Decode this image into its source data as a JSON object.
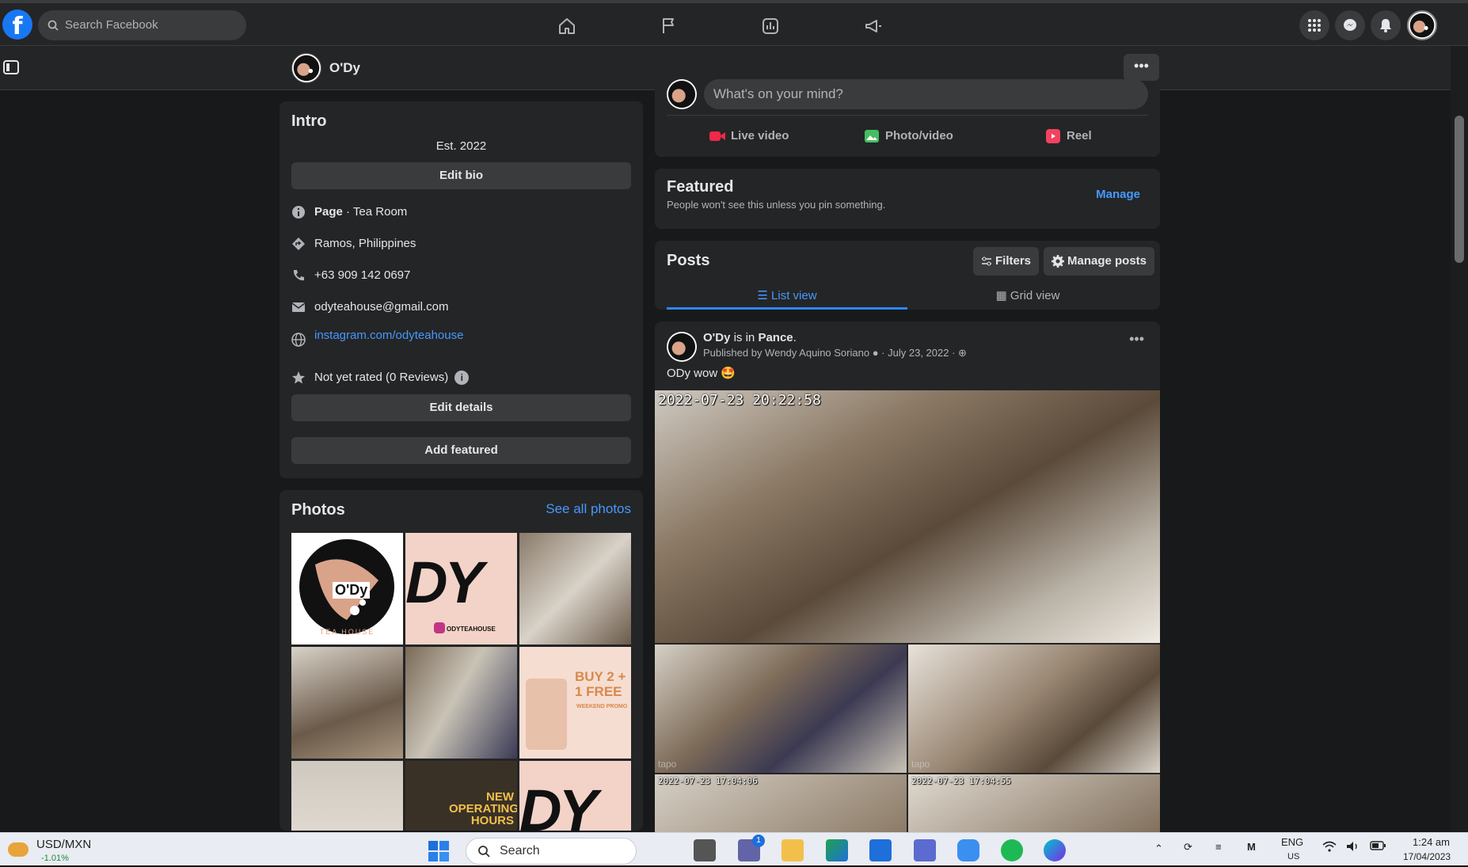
{
  "topbar": {
    "logo": "f",
    "search_placeholder": "Search Facebook"
  },
  "pagebar": {
    "page_name": "O'Dy",
    "more": "•••"
  },
  "intro": {
    "title": "Intro",
    "est": "Est. 2022",
    "edit_bio": "Edit bio",
    "page_label_bold": "Page",
    "page_label_rest": " · Tea Room",
    "location": "Ramos, Philippines",
    "phone": "+63 909 142 0697",
    "email": "odyteahouse@gmail.com",
    "website": "instagram.com/odyteahouse",
    "rating": "Not yet rated (0 Reviews)",
    "edit_details": "Edit details",
    "add_featured": "Add featured"
  },
  "photos": {
    "title": "Photos",
    "see_all": "See all photos",
    "tiles": [
      {
        "label": "O'Dy",
        "sub": "TEA HOUSE"
      },
      {
        "label": "DY",
        "sub": "ODYTEAHOUSE"
      },
      {
        "label": "",
        "sub": ""
      },
      {
        "label": "",
        "sub": ""
      },
      {
        "label": "",
        "sub": ""
      },
      {
        "label": "BUY 2 + 1 FREE",
        "sub": "WEEKEND PROMO"
      },
      {
        "label": "",
        "sub": ""
      },
      {
        "label": "NEW OPERATING HOURS",
        "sub": ""
      },
      {
        "label": "DY",
        "sub": ""
      }
    ]
  },
  "composer": {
    "placeholder": "What's on your mind?",
    "live": "Live video",
    "photo": "Photo/video",
    "reel": "Reel"
  },
  "featured": {
    "title": "Featured",
    "subtitle": "People won't see this unless you pin something.",
    "manage": "Manage"
  },
  "posts": {
    "title": "Posts",
    "filters": "Filters",
    "manage_posts": "Manage posts",
    "list_view": "List view",
    "grid_view": "Grid view"
  },
  "post": {
    "author": "O'Dy",
    "is_in": " is in ",
    "place": "Pance",
    "published_by": "Published by Wendy Aquino Soriano",
    "date": "July 23, 2022",
    "text": "ODy wow 🤩",
    "ts_main": "2022-07-23 20:22:58",
    "ts_left": "2022-07-23 17:04:06",
    "ts_right": "2022-07-23 17:04:55",
    "tapo": "tapo"
  },
  "taskbar": {
    "ticker_label": "USD/MXN",
    "ticker_value": "-1.01%",
    "search": "Search",
    "badge": "1",
    "lang": "ENG",
    "region": "US",
    "time": "1:24 am",
    "date": "17/04/2023"
  },
  "colors": {
    "accent": "#4599ff",
    "background": "#18191a",
    "card": "#242526"
  }
}
